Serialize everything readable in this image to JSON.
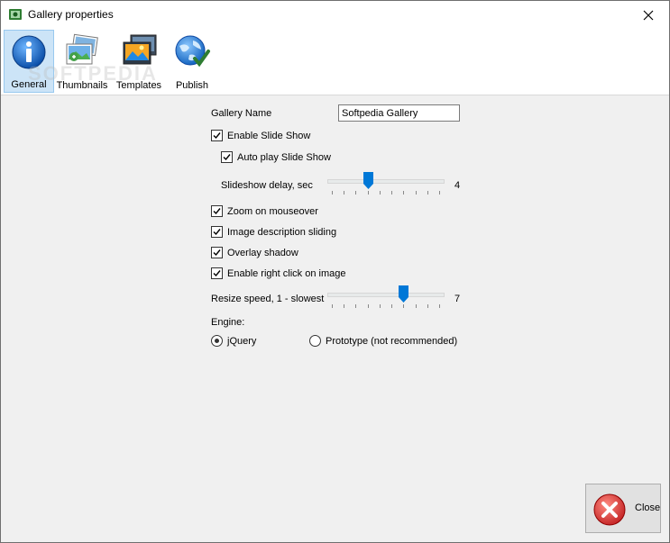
{
  "window": {
    "title": "Gallery properties"
  },
  "toolbar": {
    "items": [
      {
        "label": "General"
      },
      {
        "label": "Thumbnails"
      },
      {
        "label": "Templates"
      },
      {
        "label": "Publish"
      }
    ]
  },
  "watermark": "SOFTPEDIA",
  "form": {
    "gallery_name_label": "Gallery Name",
    "gallery_name_value": "Softpedia Gallery",
    "enable_slideshow": {
      "label": "Enable Slide Show",
      "checked": true
    },
    "auto_play": {
      "label": "Auto play Slide Show",
      "checked": true
    },
    "slideshow_delay": {
      "label": "Slideshow delay, sec",
      "value": 4,
      "value_text": "4",
      "min": 1,
      "max": 10
    },
    "zoom_mouseover": {
      "label": "Zoom on mouseover",
      "checked": true
    },
    "description_sliding": {
      "label": "Image description sliding",
      "checked": true
    },
    "overlay_shadow": {
      "label": "Overlay shadow",
      "checked": true
    },
    "right_click": {
      "label": "Enable right click on image",
      "checked": true
    },
    "resize_speed": {
      "label": "Resize speed, 1 - slowest",
      "value": 7,
      "value_text": "7",
      "min": 1,
      "max": 10
    },
    "engine_label": "Engine:",
    "engine_jquery": {
      "label": "jQuery",
      "selected": true
    },
    "engine_prototype": {
      "label": "Prototype (not recommended)",
      "selected": false
    }
  },
  "close_button": {
    "label": "Close"
  },
  "colors": {
    "accent": "#0078d7",
    "toolbar_selected": "#cce4f7"
  }
}
